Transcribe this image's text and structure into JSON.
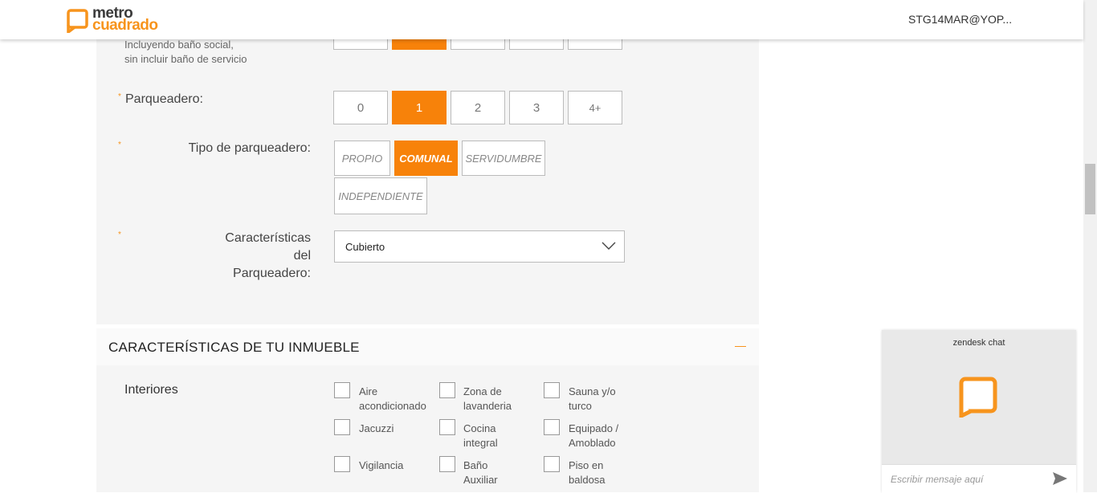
{
  "header": {
    "logo_line1": "metro",
    "logo_line2": "cuadrado",
    "user": "STG14MAR@YOP..."
  },
  "bathrooms": {
    "hint_line1": "Incluyendo baño social,",
    "hint_line2": "sin incluir baño de servicio",
    "selected_index": 1
  },
  "parking": {
    "required_mark": "*",
    "label": "Parqueadero:",
    "options": [
      "0",
      "1",
      "2",
      "3",
      "4+"
    ],
    "selected": "1"
  },
  "parking_type": {
    "required_mark": "*",
    "label": "Tipo de parqueadero:",
    "options": [
      "PROPIO",
      "COMUNAL",
      "SERVIDUMBRE",
      "INDEPENDIENTE"
    ],
    "selected": "COMUNAL"
  },
  "parking_features": {
    "required_mark": "*",
    "label": "Características del Parqueadero:",
    "value": "Cubierto"
  },
  "section": {
    "title": "CARACTERÍSTICAS DE TU INMUEBLE",
    "collapse_icon": "minus-icon",
    "interiores_label": "Interiores",
    "checkboxes": [
      [
        "Aire",
        "acondicionado"
      ],
      [
        "Zona de",
        "lavanderia"
      ],
      [
        "Sauna y/o",
        "turco"
      ],
      [
        "Jacuzzi",
        ""
      ],
      [
        "Cocina",
        "integral"
      ],
      [
        "Equipado /",
        "Amoblado"
      ],
      [
        "Vigilancia",
        ""
      ],
      [
        "Baño",
        "Auxiliar"
      ],
      [
        "Piso en",
        "baldosa"
      ]
    ]
  },
  "chat": {
    "title": "zendesk chat",
    "placeholder": "Escribir mensaje aquí",
    "send_icon": "send-icon"
  },
  "colors": {
    "accent": "#f7820a",
    "panel": "#f5f5f5"
  }
}
